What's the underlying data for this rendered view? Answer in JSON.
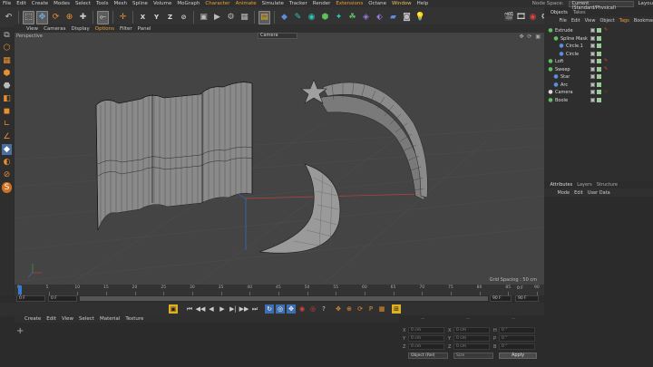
{
  "menubar": {
    "items": [
      "File",
      "Edit",
      "Create",
      "Modes",
      "Select",
      "Tools",
      "Mesh",
      "Spline",
      "Volume",
      "MoGraph",
      "Character",
      "Animate",
      "Simulate",
      "Tracker",
      "Render",
      "Extensions",
      "Octane",
      "Window",
      "Help"
    ],
    "highlight": [
      "Character",
      "Animate",
      "Extensions"
    ],
    "window_item": "Window",
    "node_space_label": "Node Space:",
    "node_space_value": "Current (Standard/Physical)",
    "layout_label": "Layou"
  },
  "viewport": {
    "menu": [
      "View",
      "Cameras",
      "Display",
      "Options",
      "Filter",
      "Panel"
    ],
    "menu_highlight": "Options",
    "label": "Perspective",
    "camera_select": "Camera",
    "grid_spacing": "Grid Spacing : 50 cm"
  },
  "timeline": {
    "ticks": [
      "0",
      "5",
      "10",
      "15",
      "20",
      "25",
      "30",
      "35",
      "40",
      "45",
      "50",
      "55",
      "60",
      "65",
      "70",
      "75",
      "80",
      "85",
      "90"
    ],
    "current_frame": "0 F",
    "start_field": "0 F",
    "start_field2": "0 F",
    "end_field": "90 F",
    "end_field2": "90 F"
  },
  "material": {
    "menu": [
      "Create",
      "Edit",
      "View",
      "Select",
      "Material",
      "Texture"
    ]
  },
  "coords": {
    "rows": [
      {
        "l1": "X",
        "v1": "0 cm",
        "l2": "X",
        "v2": "0 cm",
        "l3": "H",
        "v3": "0 °"
      },
      {
        "l1": "Y",
        "v1": "0 cm",
        "l2": "Y",
        "v2": "0 cm",
        "l3": "P",
        "v3": "0 °"
      },
      {
        "l1": "Z",
        "v1": "0 cm",
        "l2": "Z",
        "v2": "0 cm",
        "l3": "B",
        "v3": "0 °"
      }
    ],
    "headers": [
      "—",
      "—",
      "—"
    ],
    "object_select": "Object (Rel)",
    "size_select": "Size",
    "apply": "Apply"
  },
  "objects": {
    "tabs": [
      "Objects",
      "Takes"
    ],
    "menu": [
      "File",
      "Edit",
      "View",
      "Object",
      "Tags",
      "Bookmarks"
    ],
    "menu_highlight": "Tags",
    "items": [
      {
        "name": "Extrude",
        "indent": 0,
        "icon": "extrude-icon",
        "color": "#60c060",
        "tag": "✎"
      },
      {
        "name": "Spline Mask",
        "indent": 1,
        "icon": "spline-mask-icon",
        "color": "#60c060",
        "tag": ""
      },
      {
        "name": "Circle.1",
        "indent": 2,
        "icon": "circle-icon",
        "color": "#5a8fe0",
        "tag": ""
      },
      {
        "name": "Circle",
        "indent": 2,
        "icon": "circle-icon",
        "color": "#5a8fe0",
        "tag": ""
      },
      {
        "name": "Loft",
        "indent": 0,
        "icon": "loft-icon",
        "color": "#60c060",
        "tag": "✎"
      },
      {
        "name": "Sweep",
        "indent": 0,
        "icon": "sweep-icon",
        "color": "#60c060",
        "tag": "✎"
      },
      {
        "name": "Star",
        "indent": 1,
        "icon": "star-icon",
        "color": "#5a8fe0",
        "tag": ""
      },
      {
        "name": "Arc",
        "indent": 1,
        "icon": "arc-icon",
        "color": "#5a8fe0",
        "tag": ""
      },
      {
        "name": "Camera",
        "indent": 0,
        "icon": "camera-icon",
        "color": "#ddd",
        "tag": "::"
      },
      {
        "name": "Boole",
        "indent": 0,
        "icon": "boole-icon",
        "color": "#60c060",
        "tag": ""
      }
    ]
  },
  "attributes": {
    "tabs": [
      "Attributes",
      "Layers",
      "Structure"
    ],
    "menu": [
      "Mode",
      "Edit",
      "User Data"
    ]
  }
}
